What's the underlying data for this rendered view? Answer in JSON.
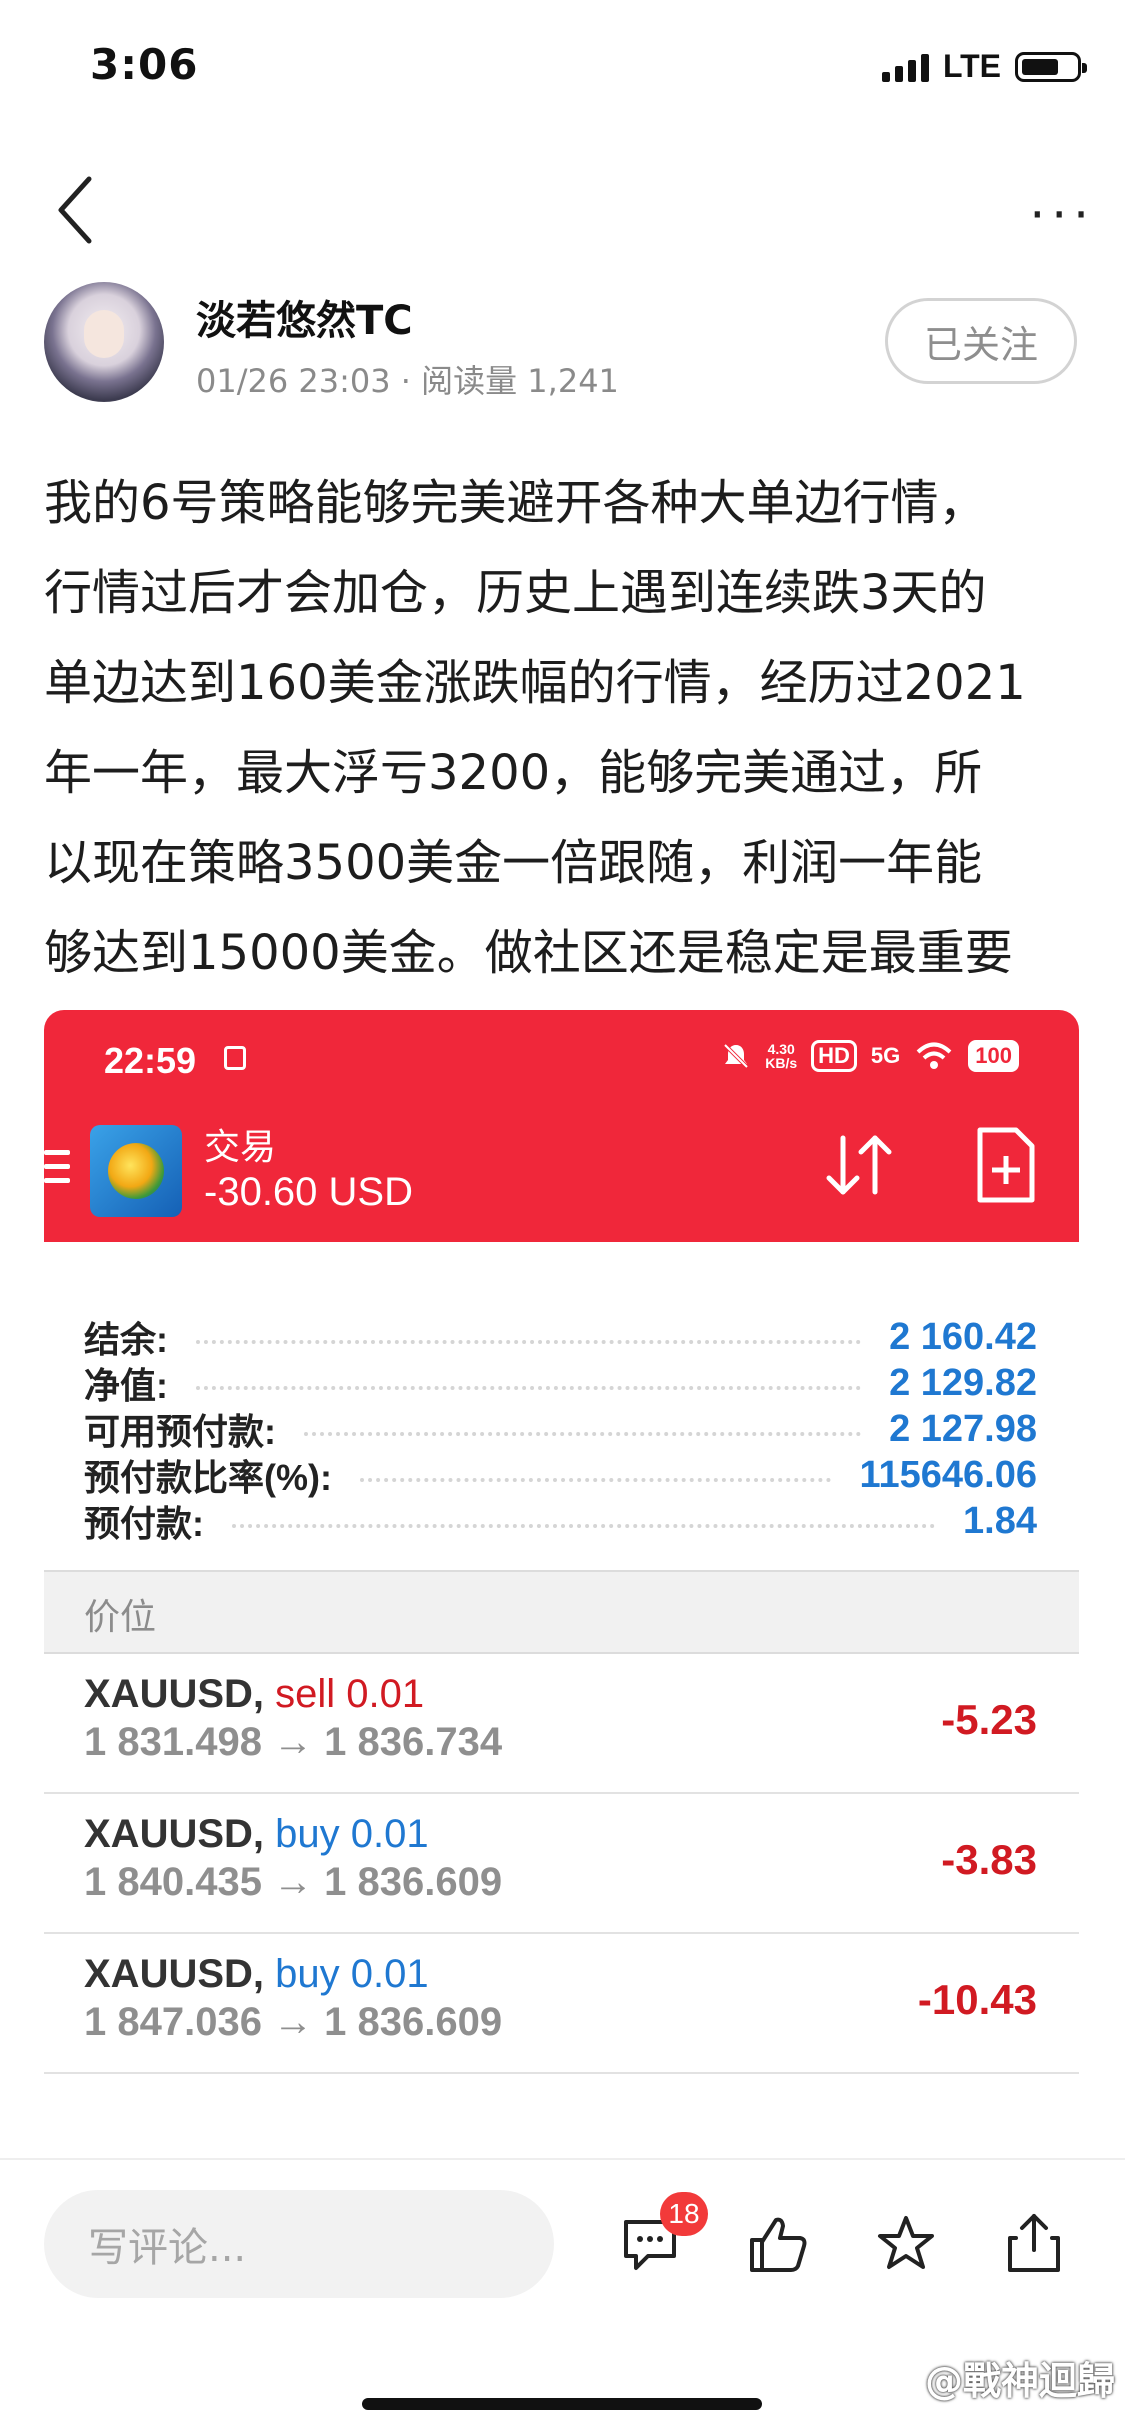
{
  "status_bar": {
    "time": "3:06",
    "network": "LTE"
  },
  "author": {
    "name": "淡若悠然TC",
    "meta": "01/26 23:03 · 阅读量 1,241",
    "follow_label": "已关注"
  },
  "article": {
    "lines": [
      "我的6号策略能够完美避开各种大单边行情，",
      "行情过后才会加仓，历史上遇到连续跌3天的",
      "单边达到160美金涨跌幅的行情，经历过2021",
      "年一年，最大浮亏3200，能够完美通过，所",
      "以现在策略3500美金一倍跟随，利润一年能",
      "够达到15000美金。做社区还是稳定是最重要"
    ]
  },
  "screenshot": {
    "status": {
      "time": "22:59",
      "speed": "4.30",
      "speed_unit": "KB/s",
      "hd": "HD",
      "net": "5G",
      "battery": "100"
    },
    "header": {
      "title": "交易",
      "balance_change": "-30.60 USD"
    },
    "account": [
      {
        "label": "结余:",
        "value": "2 160.42"
      },
      {
        "label": "净值:",
        "value": "2 129.82"
      },
      {
        "label": "可用预付款:",
        "value": "2 127.98"
      },
      {
        "label": "预付款比率(%):",
        "value": "115646.06"
      },
      {
        "label": "预付款:",
        "value": "1.84"
      }
    ],
    "price_header": "价位",
    "positions": [
      {
        "symbol": "XAUUSD,",
        "side": "sell 0.01",
        "prices": "1 831.498 → 1 836.734",
        "profit": "-5.23"
      },
      {
        "symbol": "XAUUSD,",
        "side": "buy 0.01",
        "prices": "1 840.435 → 1 836.609",
        "profit": "-3.83"
      },
      {
        "symbol": "XAUUSD,",
        "side": "buy 0.01",
        "prices": "1 847.036 → 1 836.609",
        "profit": "-10.43"
      }
    ]
  },
  "bottom_bar": {
    "comment_placeholder": "写评论...",
    "comment_count": "18"
  },
  "watermark": "@戰神迴歸",
  "colors": {
    "accent_red": "#f0273a",
    "value_blue": "#1f78d1",
    "loss_red": "#d11a22"
  }
}
